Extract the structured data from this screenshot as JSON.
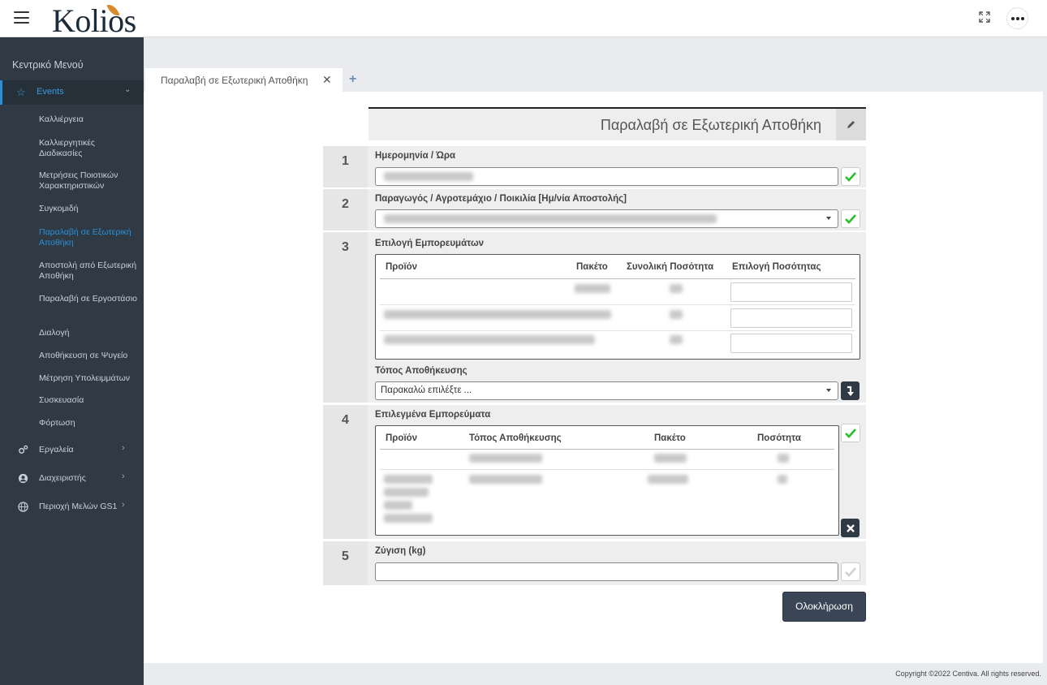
{
  "header": {
    "logo": "Kolios",
    "expand_icon": "fullscreen-icon",
    "more_icon": "more-dots-icon"
  },
  "sidebar": {
    "title": "Κεντρικό Μενού",
    "active_group": "Events",
    "events_items": [
      "Καλλιέργεια",
      "Καλλιεργητικές Διαδικασίες",
      "Μετρήσεις Ποιοτικών Χαρακτηριστικών",
      "Συγκομιδή",
      "Παραλαβή σε Εξωτερική Αποθήκη",
      "Αποστολή από Εξωτερική Αποθήκη",
      "Παραλαβή σε Εργοστάσιο",
      "Διαλογή",
      "Αποθήκευση σε Ψυγείο",
      "Μέτρηση Υπολειμμάτων",
      "Συσκευασία",
      "Φόρτωση"
    ],
    "groups": [
      "Εργαλεία",
      "Διαχειριστής",
      "Περιοχή Μελών GS1"
    ]
  },
  "tabs": {
    "active": "Παραλαβή σε Εξωτερική Αποθήκη",
    "close_icon": "close-icon",
    "add": "+"
  },
  "form": {
    "title": "Παραλαβή σε Εξωτερική Αποθήκη",
    "step1": {
      "num": "1",
      "label": "Ημερομηνία / Ώρα"
    },
    "step2": {
      "num": "2",
      "label": "Παραγωγός / Αγροτεμάχιο / Ποικιλία [Ημ/νία Αποστολής]"
    },
    "step3": {
      "num": "3",
      "label": "Επιλογή Εμπορευμάτων",
      "columns": [
        "Προϊόν",
        "Πακέτο",
        "Συνολική Ποσότητα",
        "Επιλογή Ποσότητας"
      ],
      "storage_label": "Τόπος Αποθήκευσης",
      "storage_placeholder": "Παρακαλώ επιλέξτε ..."
    },
    "step4": {
      "num": "4",
      "label": "Επιλεγμένα Εμπορεύματα",
      "columns": [
        "Προϊόν",
        "Τόπος Αποθήκευσης",
        "Πακέτο",
        "Ποσότητα"
      ]
    },
    "step5": {
      "num": "5",
      "label": "Ζύγιση (kg)"
    },
    "submit": "Ολοκλήρωση"
  },
  "footer": {
    "copyright": "Copyright ©2022 Centiva. All rights reserved."
  },
  "colors": {
    "sidebar_bg": "#2f3a45",
    "accent": "#2b8fd8",
    "check_green": "#2bbf2b",
    "button_dark": "#3a4656"
  }
}
